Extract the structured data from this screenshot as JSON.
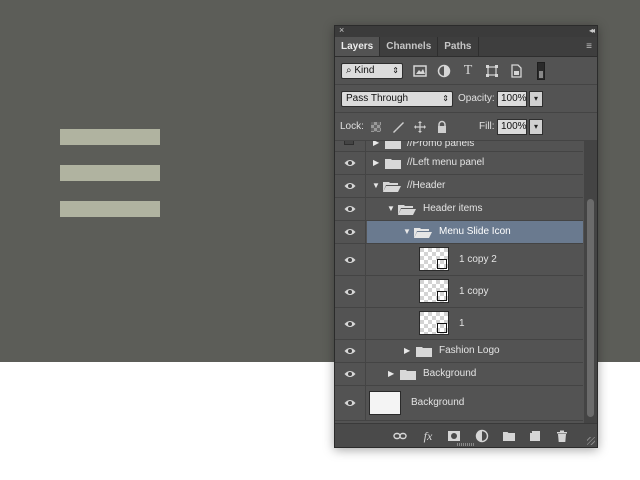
{
  "colors": {
    "canvas_bg": "#5c5d58",
    "hamburger": "#b0b3a0",
    "panel_bg": "#535353",
    "selected_row": "#6a7a8f"
  },
  "canvas": {
    "hamburger_bars": 3
  },
  "panel": {
    "close_glyph": "×",
    "collapse_glyph": "◂◂",
    "tabs": [
      {
        "label": "Layers",
        "active": true
      },
      {
        "label": "Channels",
        "active": false
      },
      {
        "label": "Paths",
        "active": false
      }
    ],
    "menu_icon": "≡",
    "filter": {
      "kind_label": "Kind",
      "search_glyph": "⌕",
      "icons": [
        "image-filter-icon",
        "adjustment-filter-icon",
        "type-filter-icon",
        "shape-filter-icon",
        "smart-object-filter-icon"
      ],
      "type_glyph": "T"
    },
    "blend": {
      "mode": "Pass Through",
      "opacity_label": "Opacity:",
      "opacity_value": "100%"
    },
    "lock": {
      "label": "Lock:",
      "fill_label": "Fill:",
      "fill_value": "100%"
    },
    "layers": [
      {
        "name": "//Promo panels",
        "type": "group",
        "expanded": false,
        "visible": false
      },
      {
        "name": "//Left menu panel",
        "type": "group",
        "expanded": false,
        "visible": true
      },
      {
        "name": "//Header",
        "type": "group",
        "expanded": true,
        "visible": true
      },
      {
        "name": "Header items",
        "type": "group",
        "expanded": true,
        "visible": true
      },
      {
        "name": "Menu Slide Icon",
        "type": "group",
        "expanded": true,
        "visible": true,
        "selected": true
      },
      {
        "name": "1 copy 2",
        "type": "layer",
        "visible": true
      },
      {
        "name": "1 copy",
        "type": "layer",
        "visible": true
      },
      {
        "name": "1",
        "type": "layer",
        "visible": true
      },
      {
        "name": "Fashion Logo",
        "type": "group",
        "expanded": false,
        "visible": true
      },
      {
        "name": "Background",
        "type": "group",
        "expanded": false,
        "visible": true
      },
      {
        "name": "Background",
        "type": "background",
        "visible": true
      }
    ],
    "bottom_icons": [
      "link-layers-icon",
      "fx-icon",
      "add-mask-icon",
      "adjustment-layer-icon",
      "new-group-icon",
      "new-layer-icon",
      "trash-icon"
    ],
    "fx_label": "fx"
  }
}
